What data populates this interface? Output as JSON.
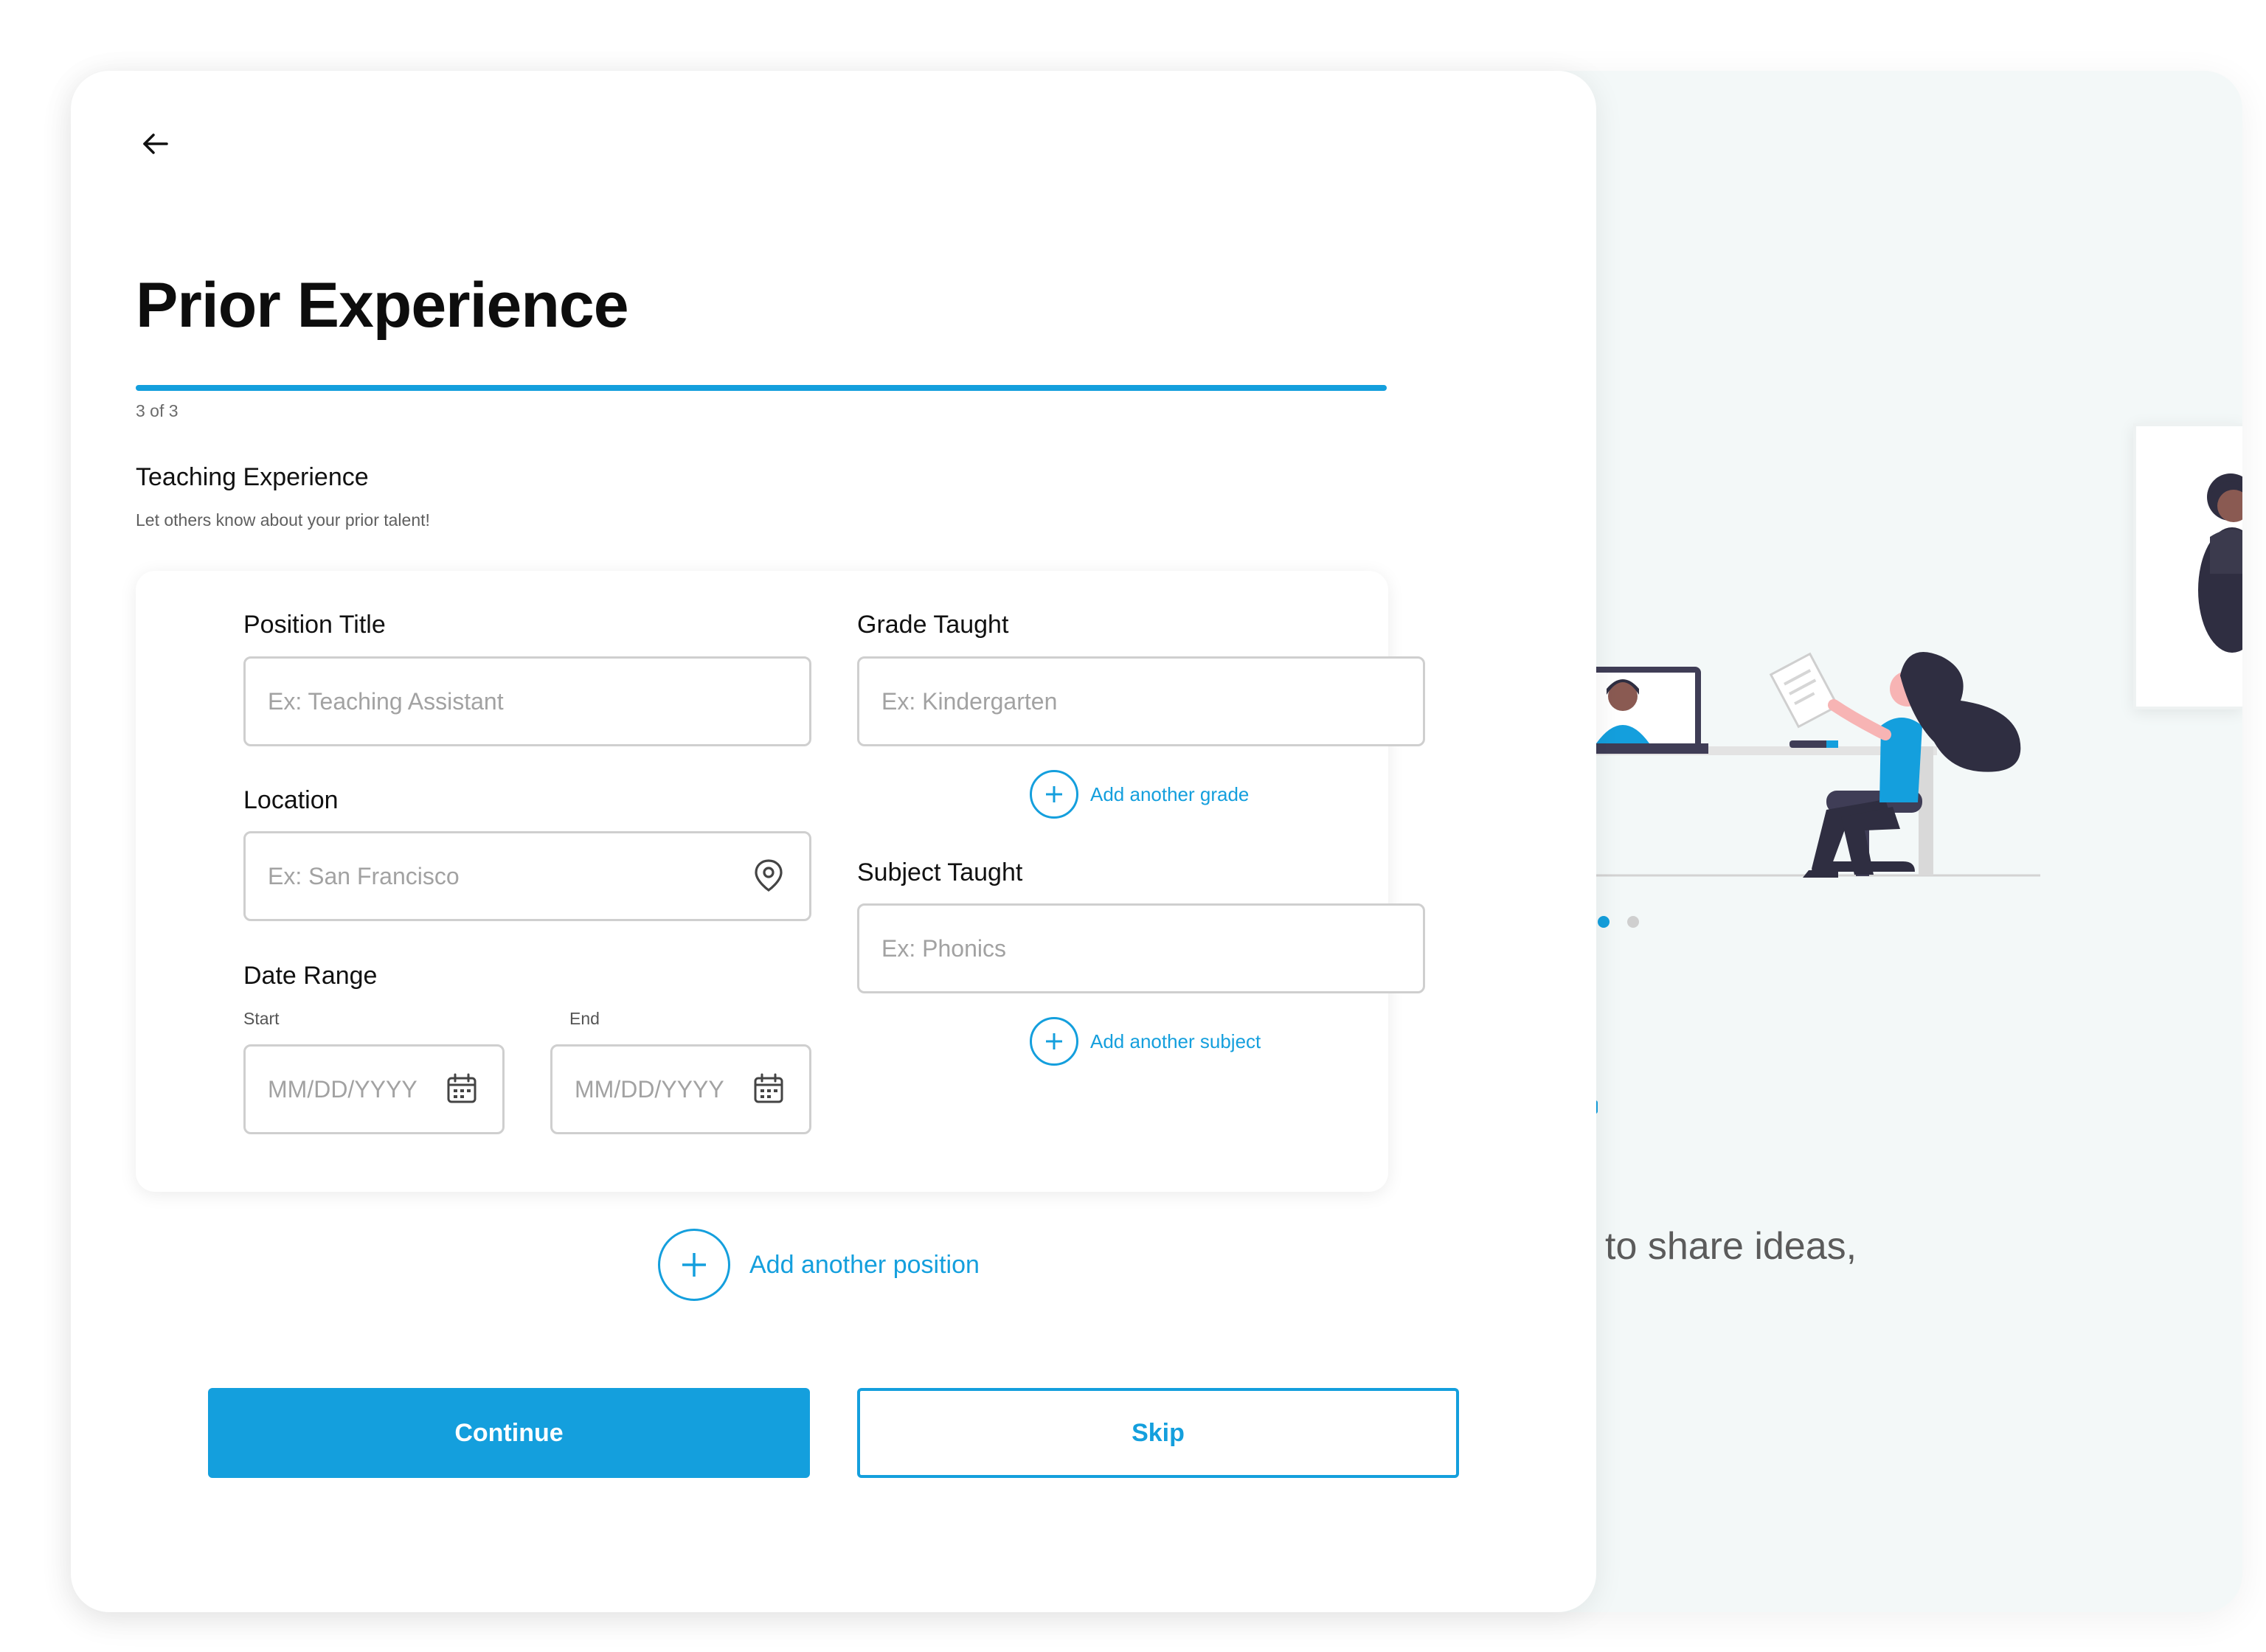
{
  "page": {
    "title": "Prior Experience",
    "back_icon": "arrow-left-icon",
    "progress": {
      "current": 3,
      "total": 3,
      "label": "3 of 3",
      "fraction": 1.0
    },
    "section": {
      "heading": "Teaching Experience",
      "subheading": "Let others know about your prior talent!"
    }
  },
  "form": {
    "position_title": {
      "label": "Position Title",
      "placeholder": "Ex: Teaching Assistant",
      "value": ""
    },
    "location": {
      "label": "Location",
      "placeholder": "Ex: San Francisco",
      "value": "",
      "icon": "map-pin-icon"
    },
    "date_range": {
      "label": "Date Range",
      "start": {
        "label": "Start",
        "placeholder": "MM/DD/YYYY",
        "icon": "calendar-icon"
      },
      "end": {
        "label": "End",
        "placeholder": "MM/DD/YYYY",
        "icon": "calendar-icon"
      }
    },
    "grade_taught": {
      "label": "Grade Taught",
      "placeholder": "Ex: Kindergarten",
      "value": "",
      "add_label": "Add another grade"
    },
    "subject_taught": {
      "label": "Subject Taught",
      "placeholder": "Ex: Phonics",
      "value": "",
      "add_label": "Add another subject"
    }
  },
  "add_position_label": "Add another position",
  "buttons": {
    "continue": "Continue",
    "skip": "Skip"
  },
  "background": {
    "tagline": "to share ideas,",
    "carousel": {
      "dots": 2,
      "active": 1
    },
    "illustration": "woman-at-desk-video-call-illustration"
  },
  "colors": {
    "accent": "#149fdd",
    "background_panel": "#f3f8f8",
    "text": "#0d0d0d",
    "input_border": "#cfcfcf",
    "placeholder": "#a2a2a2"
  }
}
